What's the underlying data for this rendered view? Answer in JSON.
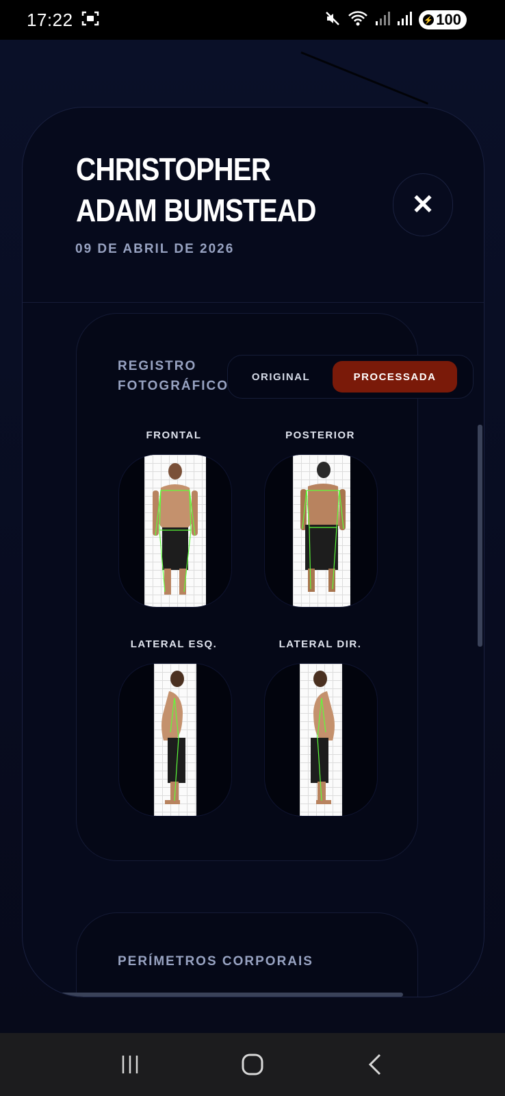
{
  "status_bar": {
    "time": "17:22",
    "battery": "100",
    "icons": [
      "screenshot-icon",
      "mute-icon",
      "wifi-icon",
      "signal-icon",
      "signal-icon",
      "battery-icon"
    ]
  },
  "header": {
    "name": "CHRISTOPHER ADAM BUMSTEAD",
    "date": "09 DE ABRIL DE 2026",
    "close_icon": "close-icon"
  },
  "photo_record": {
    "title": "REGISTRO FOTOGRÁFICO",
    "toggle": {
      "original": "ORIGINAL",
      "processed": "PROCESSADA",
      "selected": "PROCESSADA"
    },
    "views": [
      {
        "label": "FRONTAL"
      },
      {
        "label": "POSTERIOR"
      },
      {
        "label": "LATERAL ESQ."
      },
      {
        "label": "LATERAL DIR."
      }
    ]
  },
  "perimeters": {
    "title": "PERÍMETROS CORPORAIS"
  },
  "nav_bar": {
    "icons": [
      "recent-apps-icon",
      "home-icon",
      "back-icon"
    ]
  },
  "colors": {
    "accent": "#7a1a09",
    "background": "#070b1c",
    "muted_text": "#98a3c2",
    "skeleton_overlay": "#5cff3a"
  }
}
